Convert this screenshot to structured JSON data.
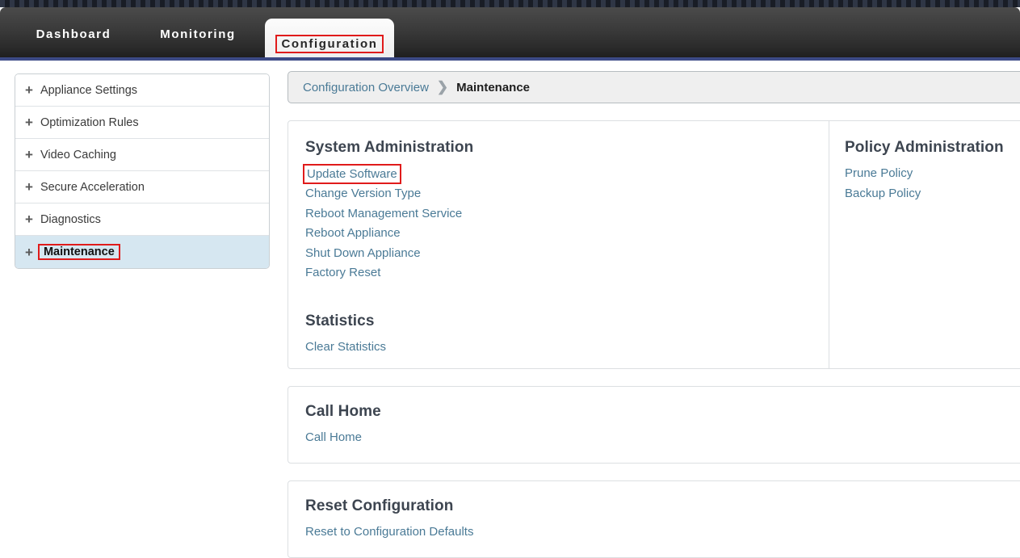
{
  "header": {
    "tabs": [
      {
        "label": "Dashboard",
        "active": false
      },
      {
        "label": "Monitoring",
        "active": false
      },
      {
        "label": "Configuration",
        "active": true
      }
    ]
  },
  "sidebar": {
    "items": [
      {
        "label": "Appliance Settings",
        "icon": "plus-icon",
        "selected": false
      },
      {
        "label": "Optimization Rules",
        "icon": "plus-icon",
        "selected": false
      },
      {
        "label": "Video Caching",
        "icon": "plus-icon",
        "selected": false
      },
      {
        "label": "Secure Acceleration",
        "icon": "plus-icon",
        "selected": false
      },
      {
        "label": "Diagnostics",
        "icon": "plus-icon",
        "selected": false
      },
      {
        "label": "Maintenance",
        "icon": "plus-icon",
        "selected": true
      }
    ],
    "expand_glyph": "+"
  },
  "breadcrumb": {
    "parent": "Configuration Overview",
    "separator": "❯",
    "current": "Maintenance"
  },
  "main": {
    "system_administration": {
      "title": "System Administration",
      "links": [
        {
          "label": "Update Software",
          "highlighted": true
        },
        {
          "label": "Change Version Type",
          "highlighted": false
        },
        {
          "label": "Reboot Management Service",
          "highlighted": false
        },
        {
          "label": "Reboot Appliance",
          "highlighted": false
        },
        {
          "label": "Shut Down Appliance",
          "highlighted": false
        },
        {
          "label": "Factory Reset",
          "highlighted": false
        }
      ]
    },
    "statistics": {
      "title": "Statistics",
      "links": [
        {
          "label": "Clear Statistics",
          "highlighted": false
        }
      ]
    },
    "policy_administration": {
      "title": "Policy Administration",
      "links": [
        {
          "label": "Prune Policy",
          "highlighted": false
        },
        {
          "label": "Backup Policy",
          "highlighted": false
        }
      ]
    },
    "call_home": {
      "title": "Call Home",
      "links": [
        {
          "label": "Call Home",
          "highlighted": false
        }
      ]
    },
    "reset_configuration": {
      "title": "Reset Configuration",
      "links": [
        {
          "label": "Reset to Configuration Defaults",
          "highlighted": false
        }
      ]
    }
  },
  "colors": {
    "link": "#4a7a96",
    "highlight": "#e01b1b",
    "heading": "#3d4550",
    "selected_row": "#d6e7f1",
    "header_accent": "#3c4a86"
  }
}
